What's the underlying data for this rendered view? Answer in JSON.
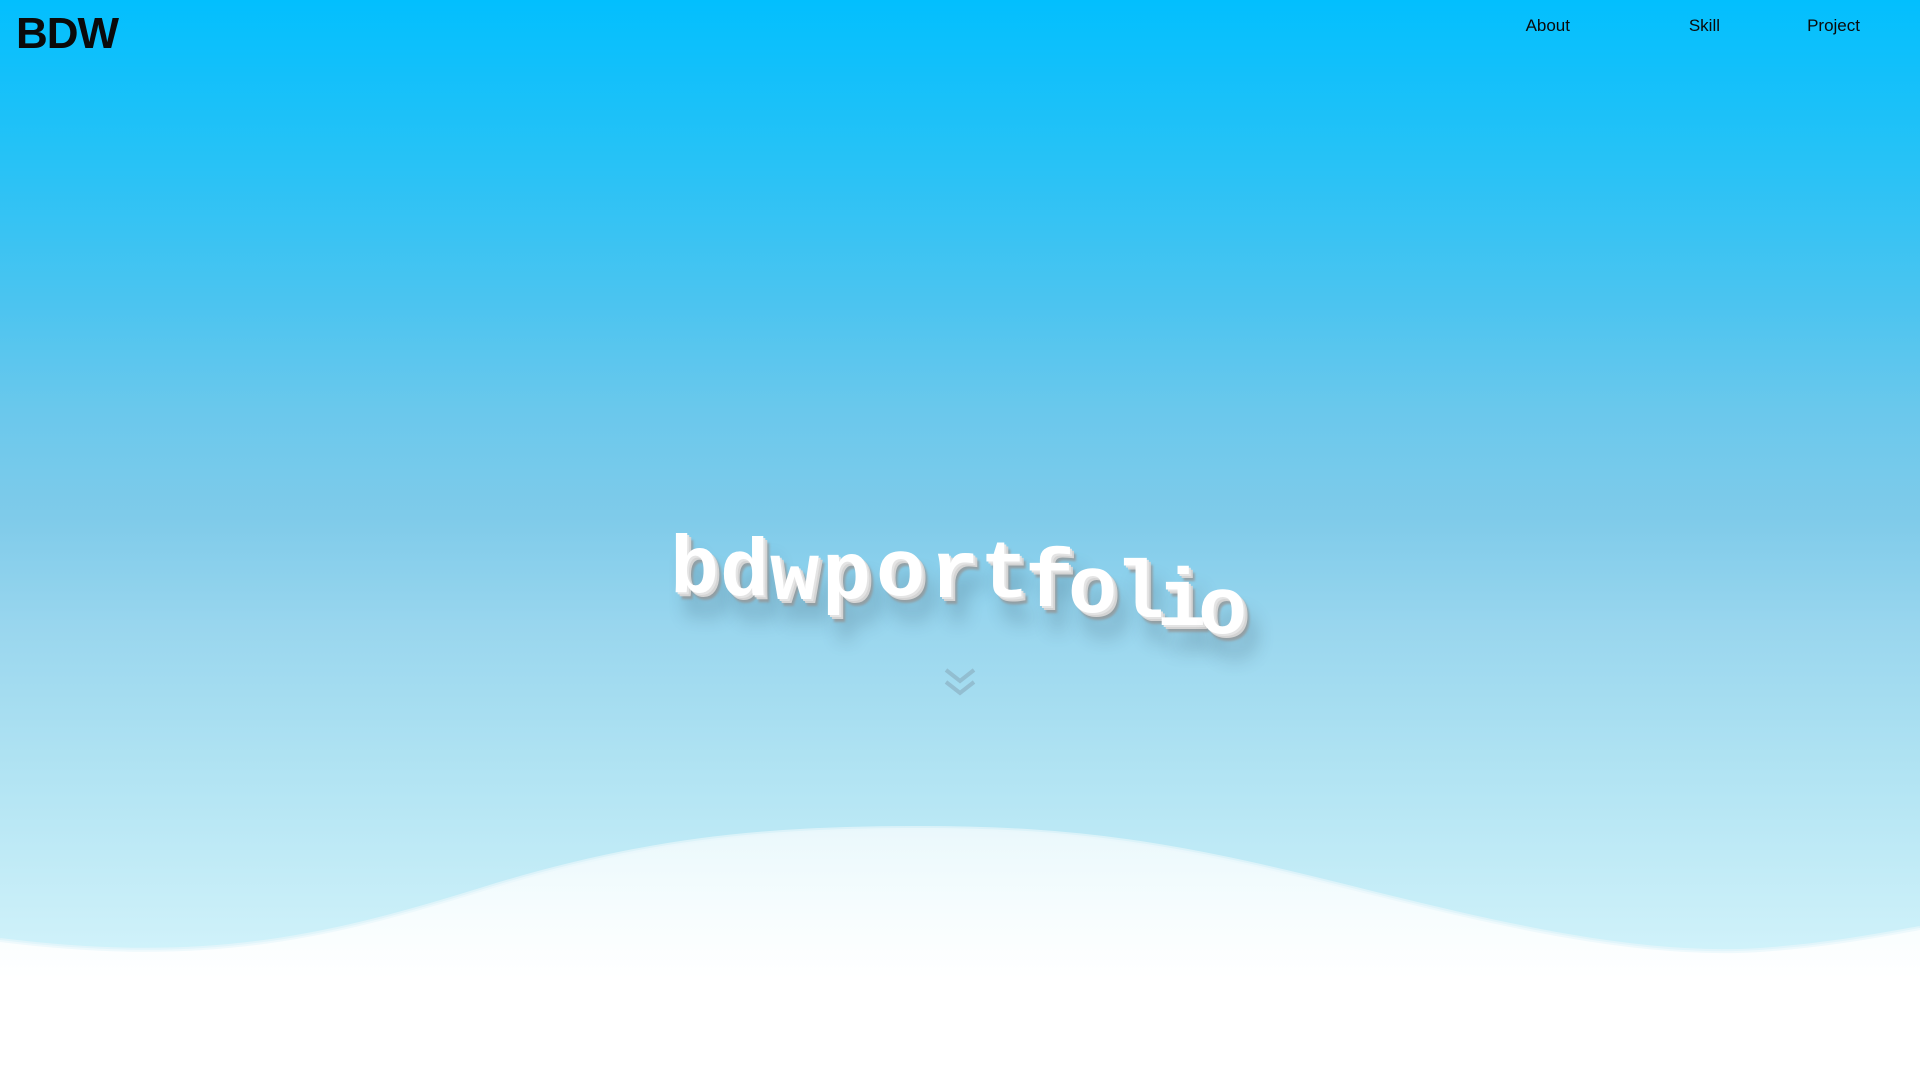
{
  "header": {
    "logo": "BDW",
    "nav": [
      {
        "label": "About"
      },
      {
        "label": "Skill"
      },
      {
        "label": "Project"
      }
    ]
  },
  "hero": {
    "title": "bdwportfolio",
    "letters": [
      "b",
      "d",
      "w",
      "p",
      "o",
      "r",
      "t",
      "f",
      "o",
      "l",
      "i",
      "o"
    ]
  },
  "icons": {
    "scroll": "double-chevron-down-icon"
  },
  "colors": {
    "sky_top": "#02bffe",
    "sky_bottom": "#e4f8fc",
    "text": "#0a0a0a",
    "letter": "#ffffff",
    "chevron": "#8ab4c8"
  }
}
